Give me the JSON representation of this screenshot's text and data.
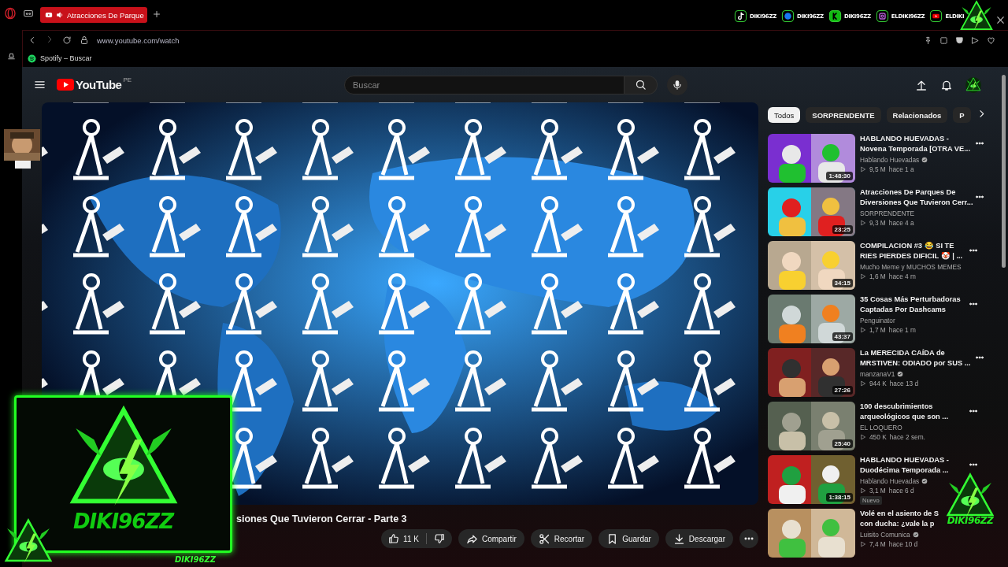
{
  "browser": {
    "tab": {
      "title": "Atracciones De Parque",
      "audio": true
    },
    "address": "www.youtube.com/watch",
    "bookmarks": [
      {
        "kind": "spotify",
        "label": "Spotify – Buscar"
      }
    ]
  },
  "stream_overlay": {
    "socials": [
      {
        "kind": "tiktok",
        "handle": "DIKI96ZZ"
      },
      {
        "kind": "facebook",
        "handle": "DIKI96ZZ"
      },
      {
        "kind": "kick",
        "handle": "DIKI96ZZ"
      },
      {
        "kind": "instagram",
        "handle": "ELDIKI96ZZ"
      },
      {
        "kind": "youtube",
        "handle": "ELDIKI"
      }
    ],
    "webcam_label": "DIKI96ZZ",
    "webcam_tag": "DIKI96ZZ",
    "corner_logo_label": "DIKI96ZZ"
  },
  "youtube": {
    "logo": "YouTube",
    "region": "PE",
    "search": {
      "placeholder": "Buscar"
    },
    "video": {
      "title": "siones Que Tuvieron Cerrar - Parte 3",
      "likes": "11 K",
      "actions": [
        {
          "kind": "share",
          "label": "Compartir"
        },
        {
          "kind": "clip",
          "label": "Recortar"
        },
        {
          "kind": "save",
          "label": "Guardar"
        },
        {
          "kind": "download",
          "label": "Descargar"
        }
      ]
    },
    "chips": [
      {
        "label": "Todos",
        "selected": true
      },
      {
        "label": "SORPRENDENTE",
        "selected": false
      },
      {
        "label": "Relacionados",
        "selected": false
      },
      {
        "label": "P",
        "selected": false
      }
    ],
    "recommendations": [
      {
        "title": [
          "HABLANDO HUEVADAS -",
          "Novena Temporada [OTRA VE..."
        ],
        "channel": "Hablando Huevadas",
        "verified": true,
        "views": "9,5 M",
        "age": "hace 1 a",
        "duration": "1:48:30"
      },
      {
        "title": [
          "Atracciones De Parques De",
          "Diversiones Que Tuvieron Cerr..."
        ],
        "channel": "SORPRENDENTE",
        "verified": false,
        "views": "9,3 M",
        "age": "hace 4 a",
        "duration": "23:25"
      },
      {
        "title": [
          "COMPILACION #3 😂 SI TE",
          "RIES PIERDES DIFICIL 🤡 | ..."
        ],
        "channel": "Mucho Meme y MUCHOS MEMES",
        "verified": false,
        "views": "1,6 M",
        "age": "hace 4 m",
        "duration": "34:15"
      },
      {
        "title": [
          "35 Cosas Más Perturbadoras",
          "Captadas Por Dashcams"
        ],
        "channel": "Penguinator",
        "verified": false,
        "views": "1,7 M",
        "age": "hace 1 m",
        "duration": "43:37"
      },
      {
        "title": [
          "La MERECIDA CAÍDA de",
          "MRSTIVEN: ODIADO por SUS ..."
        ],
        "channel": "manzanaV1",
        "verified": true,
        "views": "944 K",
        "age": "hace 13 d",
        "duration": "27:26"
      },
      {
        "title": [
          "100 descubrimientos",
          "arqueológicos que son ..."
        ],
        "channel": "EL LOQUERO",
        "verified": false,
        "views": "450 K",
        "age": "hace 2 sem.",
        "duration": "25:40"
      },
      {
        "title": [
          "HABLANDO HUEVADAS -",
          "Duodécima Temporada ..."
        ],
        "channel": "Hablando Huevadas",
        "verified": true,
        "views": "3,1 M",
        "age": "hace 6 d",
        "duration": "1:38:15",
        "badge": "Nuevo"
      },
      {
        "title": [
          "Volé en el asiento de S",
          "con ducha: ¿vale la p"
        ],
        "channel": "Luisito Comunica",
        "verified": true,
        "views": "7,4 M",
        "age": "hace 10 d"
      }
    ]
  }
}
